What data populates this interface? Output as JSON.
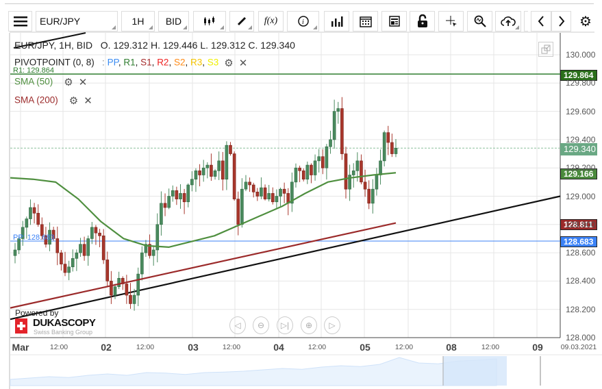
{
  "toolbar": {
    "menu_icon": "hamburger-icon",
    "symbol": "EUR/JPY",
    "timeframe": "1H",
    "side": "BID",
    "fx_label": "f(x)",
    "icons": [
      "candlestick-icon",
      "pencil-icon",
      "function-icon",
      "info-icon",
      "bar-chart-icon",
      "calendar-icon",
      "news-icon",
      "lock-icon",
      "crosshair-icon",
      "zoom-search-icon",
      "cloud-upload-icon",
      "chevron-left-icon",
      "chevron-right-icon",
      "gear-icon"
    ]
  },
  "legend": {
    "ohlc_title": "EUR/JPY, 1H, BID",
    "ohlc": "O. 129.312 H. 129.446 L. 129.312 C. 129.340",
    "pivot": "PIVOTPOINT (0, 8)",
    "pivot_sep": ":",
    "pivot_levels": [
      {
        "t": "PP",
        "c": "#3b8cf2"
      },
      {
        "t": "R1",
        "c": "#2f7d2f"
      },
      {
        "t": "S1",
        "c": "#a52a2a"
      },
      {
        "t": "R2",
        "c": "#ee2222"
      },
      {
        "t": "S2",
        "c": "#ff8c1a"
      },
      {
        "t": "R3",
        "c": "#f5c400"
      },
      {
        "t": "S3",
        "c": "#f0f000"
      }
    ],
    "sma50": "SMA (50)",
    "sma200": "SMA (200)",
    "r1_label": "R1: 129.864",
    "pp_label": "PP: 128.683"
  },
  "price_tags": {
    "r1": "129.864",
    "last": "129.340",
    "sma50": "129.166",
    "sma200": "128.811",
    "pp": "128.683"
  },
  "colors": {
    "up": "#4a8a5e",
    "down": "#a8372c",
    "sma50": "#4f8f3f",
    "sma200": "#9b2a2a",
    "r1": "#2f7d2f",
    "pp": "#3b82f6"
  },
  "branding": {
    "powered": "Powered by",
    "name": "DUKASCOPY",
    "tagline": "Swiss Banking Group"
  },
  "chart_data": {
    "type": "candlestick",
    "title": "EUR/JPY, 1H, BID",
    "ylim": [
      128.0,
      130.0
    ],
    "yticks": [
      "130.000",
      "129.800",
      "129.600",
      "129.400",
      "129.200",
      "129.000",
      "128.800",
      "128.600",
      "128.400",
      "128.200",
      "128.000"
    ],
    "xticks": [
      {
        "t": "Mar",
        "day": true
      },
      {
        "t": "12:00"
      },
      {
        "t": "02",
        "day": true
      },
      {
        "t": "12:00"
      },
      {
        "t": "03",
        "day": true
      },
      {
        "t": "12:00"
      },
      {
        "t": "04",
        "day": true
      },
      {
        "t": "12:00"
      },
      {
        "t": "05",
        "day": true
      },
      {
        "t": "12:00"
      },
      {
        "t": "08",
        "day": true
      },
      {
        "t": "12:00"
      },
      {
        "t": "09",
        "day": true
      },
      {
        "t": "09.03.2021"
      }
    ],
    "closes": [
      128.62,
      128.7,
      128.78,
      128.84,
      128.92,
      128.88,
      128.8,
      128.72,
      128.66,
      128.76,
      128.7,
      128.6,
      128.52,
      128.46,
      128.5,
      128.56,
      128.6,
      128.66,
      128.58,
      128.7,
      128.78,
      128.74,
      128.72,
      128.55,
      128.4,
      128.3,
      128.36,
      128.42,
      128.38,
      128.3,
      128.24,
      128.3,
      128.45,
      128.6,
      128.66,
      128.58,
      128.62,
      128.8,
      128.95,
      128.92,
      129.0,
      129.04,
      128.98,
      129.02,
      128.96,
      129.08,
      129.12,
      129.18,
      129.15,
      129.2,
      129.22,
      129.14,
      129.18,
      129.25,
      129.12,
      129.36,
      129.3,
      128.98,
      128.8,
      129.05,
      129.1,
      129.08,
      129.03,
      129.0,
      129.06,
      128.98,
      129.02,
      128.96,
      129.0,
      129.05,
      129.02,
      128.95,
      129.1,
      129.2,
      129.18,
      129.12,
      129.22,
      129.15,
      129.25,
      129.28,
      129.2,
      129.35,
      129.4,
      129.6,
      129.62,
      129.3,
      129.05,
      129.15,
      129.18,
      129.25,
      129.1,
      129.05,
      128.95,
      129.05,
      129.15,
      129.25,
      129.45,
      129.38,
      129.3,
      129.34
    ],
    "sma50": [
      129.13,
      129.12,
      129.1,
      128.98,
      128.82,
      128.7,
      128.65,
      128.64,
      128.68,
      128.72,
      128.79,
      128.86,
      128.93,
      129.02,
      129.1,
      129.13,
      129.15,
      129.166
    ],
    "sma200": [
      128.21,
      128.811
    ],
    "trendline": [
      128.13,
      129.0
    ],
    "last": 129.34,
    "r1": 129.864,
    "pp": 128.683
  }
}
